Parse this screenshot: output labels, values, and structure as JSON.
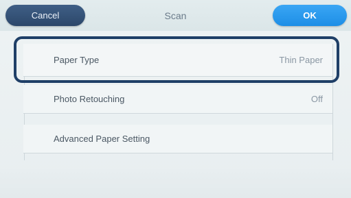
{
  "header": {
    "cancel_label": "Cancel",
    "title": "Scan",
    "ok_label": "OK"
  },
  "settings": [
    {
      "label": "Paper Type",
      "value": "Thin Paper"
    },
    {
      "label": "Photo Retouching",
      "value": "Off"
    },
    {
      "label": "Advanced Paper Setting",
      "value": ""
    }
  ],
  "colors": {
    "cancel_button": "#2f4b70",
    "ok_button": "#2896ec",
    "selection_ring": "#1f3f67"
  }
}
